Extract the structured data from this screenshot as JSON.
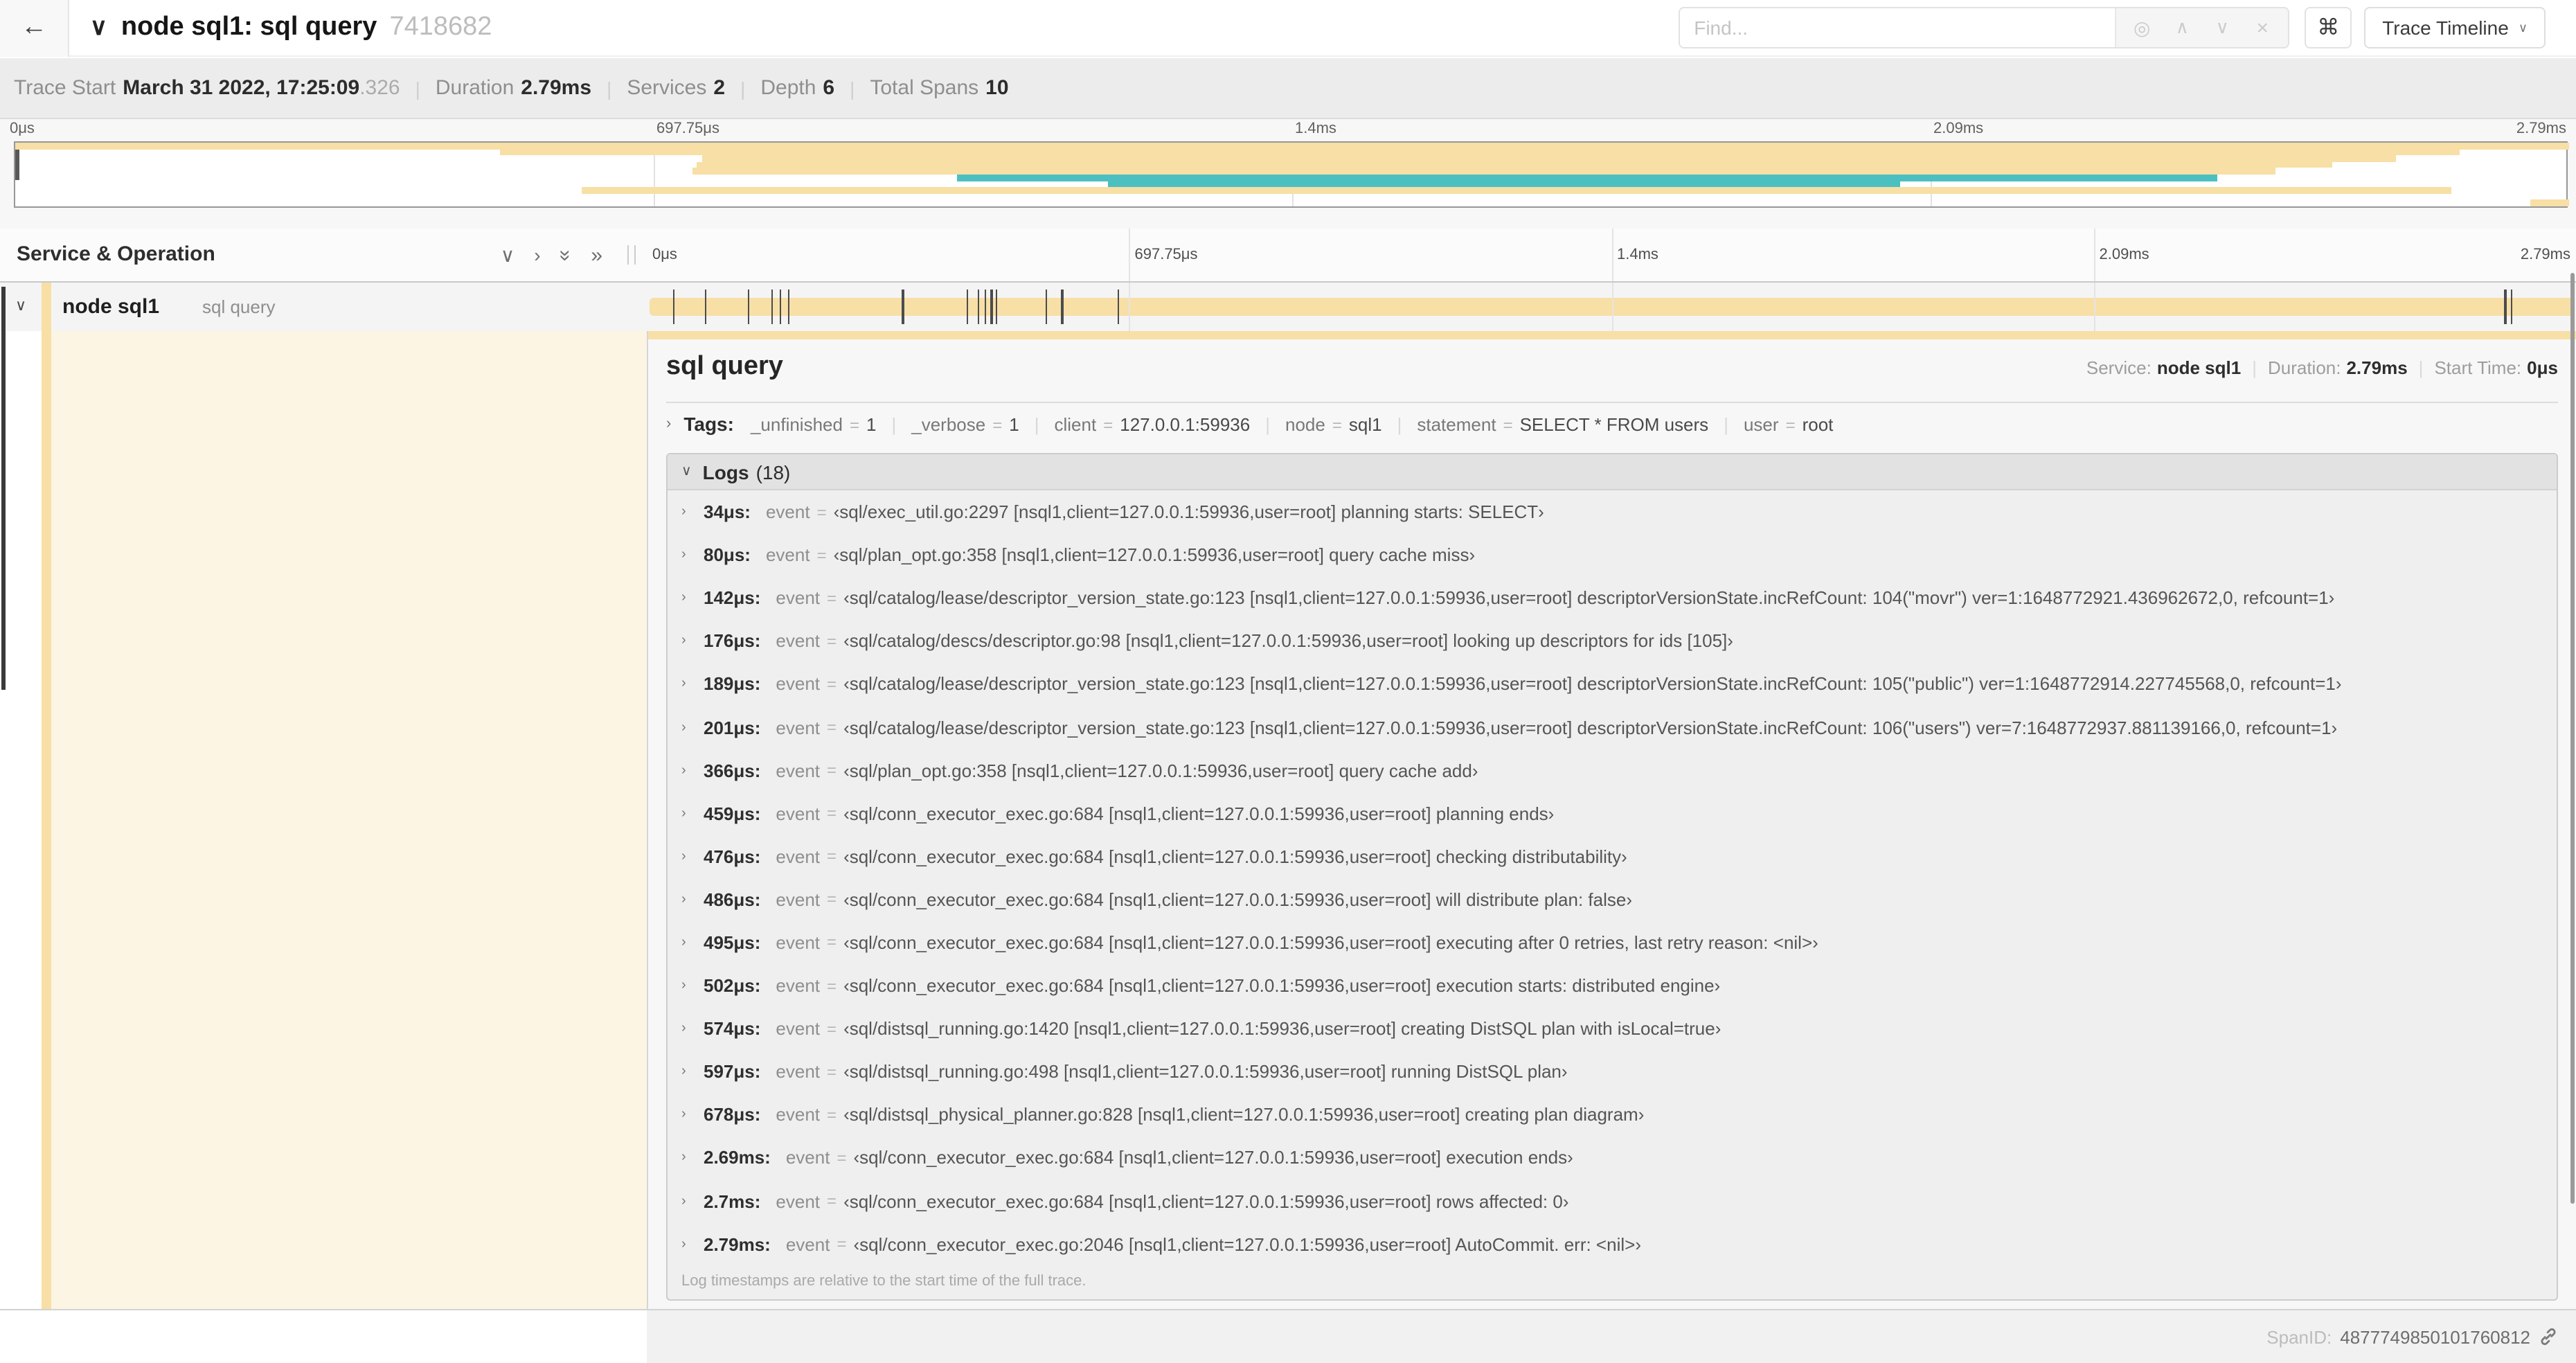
{
  "colors": {
    "tan": "#F7DFA6",
    "teal": "#4CC0C0",
    "cream": "#FCF5E4"
  },
  "header": {
    "back_icon": "←",
    "collapse_icon": "∨",
    "title": "node sql1: sql query",
    "trace_id": "7418682",
    "search": {
      "placeholder": "Find...",
      "locate_icon": "◎",
      "prev_icon": "∧",
      "next_icon": "∨",
      "clear_icon": "×"
    },
    "shortcut_button": "⌘",
    "view_dropdown": {
      "label": "Trace Timeline",
      "caret": "∨"
    }
  },
  "trace_info": {
    "items": [
      {
        "label": "Trace Start",
        "value": "March 31 2022, 17:25:09",
        "muted_suffix": ".326"
      },
      {
        "label": "Duration",
        "value": "2.79ms",
        "muted_suffix": ""
      },
      {
        "label": "Services",
        "value": "2",
        "muted_suffix": ""
      },
      {
        "label": "Depth",
        "value": "6",
        "muted_suffix": ""
      },
      {
        "label": "Total Spans",
        "value": "10",
        "muted_suffix": ""
      }
    ]
  },
  "minimap": {
    "tick_labels": [
      "0μs",
      "697.75μs",
      "1.4ms",
      "2.09ms",
      "2.79ms"
    ],
    "rows": 10,
    "spans": [
      {
        "row": 0,
        "start": 0.0,
        "end": 1.0,
        "color": "tan"
      },
      {
        "row": 1,
        "start": 0.19,
        "end": 0.957,
        "color": "tan"
      },
      {
        "row": 2,
        "start": 0.269,
        "end": 0.932,
        "color": "tan"
      },
      {
        "row": 3,
        "start": 0.267,
        "end": 0.907,
        "color": "tan"
      },
      {
        "row": 4,
        "start": 0.265,
        "end": 0.885,
        "color": "tan"
      },
      {
        "row": 5,
        "start": 0.369,
        "end": 0.862,
        "color": "teal"
      },
      {
        "row": 6,
        "start": 0.428,
        "end": 0.738,
        "color": "teal"
      },
      {
        "row": 7,
        "start": 0.222,
        "end": 0.954,
        "color": "tan"
      },
      {
        "row": 9,
        "start": 0.985,
        "end": 1.0,
        "color": "tan"
      }
    ]
  },
  "timeline": {
    "columns_header": "Service & Operation",
    "icons": {
      "collapse_one": "∨",
      "expand_one": "›",
      "collapse_all": "»",
      "expand_all": "»"
    },
    "tick_labels": [
      "0μs",
      "697.75μs",
      "1.4ms",
      "2.09ms",
      "2.79ms"
    ],
    "duration_us": 2790,
    "row": {
      "expander": "∨",
      "service": "node sql1",
      "operation": "sql query"
    }
  },
  "detail": {
    "operation": "sql query",
    "summary": [
      {
        "label": "Service:",
        "value": "node sql1"
      },
      {
        "label": "Duration:",
        "value": "2.79ms"
      },
      {
        "label": "Start Time:",
        "value": "0μs"
      }
    ],
    "tags": {
      "expander": "›",
      "label": "Tags:",
      "items": [
        {
          "key": "_unfinished",
          "value": "1"
        },
        {
          "key": "_verbose",
          "value": "1"
        },
        {
          "key": "client",
          "value": "127.0.0.1:59936"
        },
        {
          "key": "node",
          "value": "sql1"
        },
        {
          "key": "statement",
          "value": "SELECT * FROM users"
        },
        {
          "key": "user",
          "value": "root"
        }
      ]
    },
    "logs": {
      "expander": "∨",
      "label": "Logs",
      "count": "(18)",
      "field_label": "event",
      "rows": [
        {
          "time": "34μs:",
          "t_us": 34,
          "value": "‹sql/exec_util.go:2297 [nsql1,client=127.0.0.1:59936,user=root] planning starts: SELECT›"
        },
        {
          "time": "80μs:",
          "t_us": 80,
          "value": "‹sql/plan_opt.go:358 [nsql1,client=127.0.0.1:59936,user=root] query cache miss›"
        },
        {
          "time": "142μs:",
          "t_us": 142,
          "value": "‹sql/catalog/lease/descriptor_version_state.go:123 [nsql1,client=127.0.0.1:59936,user=root] descriptorVersionState.incRefCount: 104(\"movr\") ver=1:1648772921.436962672,0, refcount=1›"
        },
        {
          "time": "176μs:",
          "t_us": 176,
          "value": "‹sql/catalog/descs/descriptor.go:98 [nsql1,client=127.0.0.1:59936,user=root] looking up descriptors for ids [105]›"
        },
        {
          "time": "189μs:",
          "t_us": 189,
          "value": "‹sql/catalog/lease/descriptor_version_state.go:123 [nsql1,client=127.0.0.1:59936,user=root] descriptorVersionState.incRefCount: 105(\"public\") ver=1:1648772914.227745568,0, refcount=1›"
        },
        {
          "time": "201μs:",
          "t_us": 201,
          "value": "‹sql/catalog/lease/descriptor_version_state.go:123 [nsql1,client=127.0.0.1:59936,user=root] descriptorVersionState.incRefCount: 106(\"users\") ver=7:1648772937.881139166,0, refcount=1›"
        },
        {
          "time": "366μs:",
          "t_us": 366,
          "value": "‹sql/plan_opt.go:358 [nsql1,client=127.0.0.1:59936,user=root] query cache add›"
        },
        {
          "time": "459μs:",
          "t_us": 459,
          "value": "‹sql/conn_executor_exec.go:684 [nsql1,client=127.0.0.1:59936,user=root] planning ends›"
        },
        {
          "time": "476μs:",
          "t_us": 476,
          "value": "‹sql/conn_executor_exec.go:684 [nsql1,client=127.0.0.1:59936,user=root] checking distributability›"
        },
        {
          "time": "486μs:",
          "t_us": 486,
          "value": "‹sql/conn_executor_exec.go:684 [nsql1,client=127.0.0.1:59936,user=root] will distribute plan: false›"
        },
        {
          "time": "495μs:",
          "t_us": 495,
          "value": "‹sql/conn_executor_exec.go:684 [nsql1,client=127.0.0.1:59936,user=root] executing after 0 retries, last retry reason: <nil>›"
        },
        {
          "time": "502μs:",
          "t_us": 502,
          "value": "‹sql/conn_executor_exec.go:684 [nsql1,client=127.0.0.1:59936,user=root] execution starts: distributed engine›"
        },
        {
          "time": "574μs:",
          "t_us": 574,
          "value": "‹sql/distsql_running.go:1420 [nsql1,client=127.0.0.1:59936,user=root] creating DistSQL plan with isLocal=true›"
        },
        {
          "time": "597μs:",
          "t_us": 597,
          "value": "‹sql/distsql_running.go:498 [nsql1,client=127.0.0.1:59936,user=root] running DistSQL plan›"
        },
        {
          "time": "678μs:",
          "t_us": 678,
          "value": "‹sql/distsql_physical_planner.go:828 [nsql1,client=127.0.0.1:59936,user=root] creating plan diagram›"
        },
        {
          "time": "2.69ms:",
          "t_us": 2690,
          "value": "‹sql/conn_executor_exec.go:684 [nsql1,client=127.0.0.1:59936,user=root] execution ends›"
        },
        {
          "time": "2.7ms:",
          "t_us": 2700,
          "value": "‹sql/conn_executor_exec.go:684 [nsql1,client=127.0.0.1:59936,user=root] rows affected: 0›"
        },
        {
          "time": "2.79ms:",
          "t_us": 2790,
          "value": "‹sql/conn_executor_exec.go:2046 [nsql1,client=127.0.0.1:59936,user=root] AutoCommit. err: <nil>›"
        }
      ],
      "footer_note": "Log timestamps are relative to the start time of the full trace."
    },
    "span_id_label": "SpanID:",
    "span_id": "4877749850101760812"
  }
}
